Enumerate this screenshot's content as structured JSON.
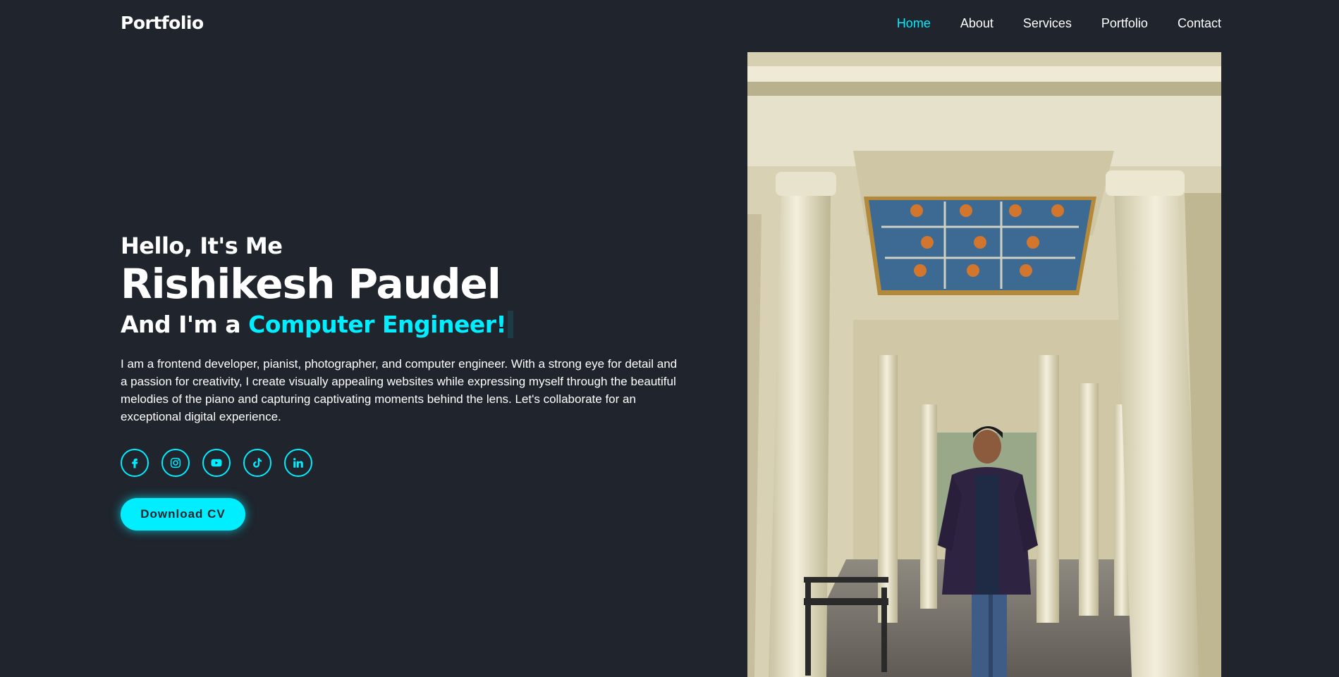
{
  "header": {
    "logo": "Portfolio",
    "nav": [
      {
        "label": "Home",
        "active": true
      },
      {
        "label": "About",
        "active": false
      },
      {
        "label": "Services",
        "active": false
      },
      {
        "label": "Portfolio",
        "active": false
      },
      {
        "label": "Contact",
        "active": false
      }
    ]
  },
  "hero": {
    "greeting": "Hello, It's Me",
    "name": "Rishikesh Paudel",
    "role_prefix": "And I'm a ",
    "role_highlight": "Computer Engineer!",
    "description": "I am a frontend developer, pianist, photographer, and computer engineer. With a strong eye for detail and a passion for creativity, I create visually appealing websites while expressing myself through the beautiful melodies of the piano and capturing captivating moments behind the lens. Let's collaborate for an exceptional digital experience.",
    "socials": [
      {
        "icon": "facebook-icon"
      },
      {
        "icon": "instagram-icon"
      },
      {
        "icon": "youtube-icon"
      },
      {
        "icon": "tiktok-icon"
      },
      {
        "icon": "linkedin-icon"
      }
    ],
    "cta_label": "Download CV"
  },
  "colors": {
    "background": "#1f242d",
    "accent": "#00eeff",
    "text": "#ffffff"
  }
}
